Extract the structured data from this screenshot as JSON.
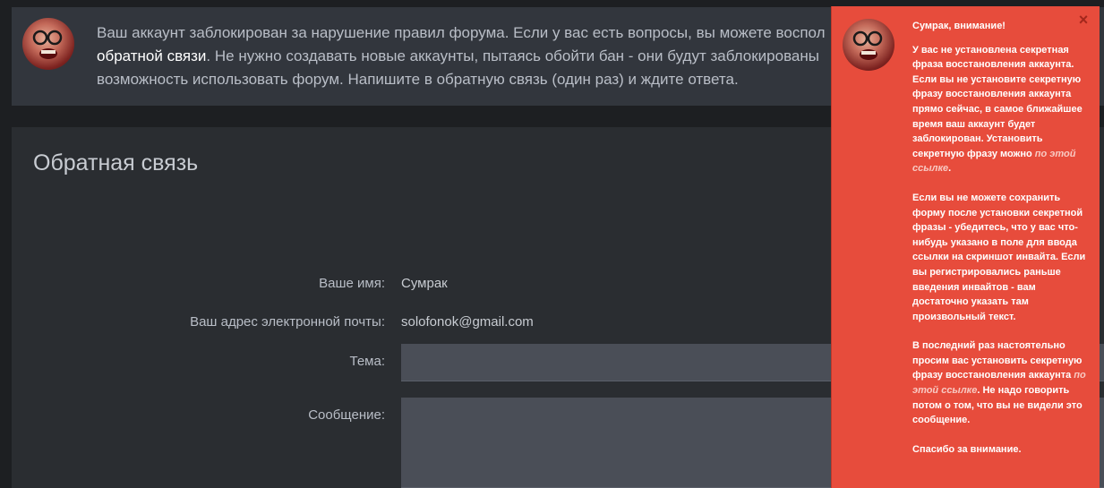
{
  "notice": {
    "text_before_link": "Ваш аккаунт заблокирован за нарушение правил форума. Если у вас есть вопросы, вы можете воспол",
    "link_text": "обратной связи",
    "text_after_link": ". Не нужно создавать новые аккаунты, пытаясь обойти бан - они будут заблокированы",
    "line3": "возможность использовать форум. Напишите в обратную связь (один раз) и ждите ответа."
  },
  "page": {
    "title": "Обратная связь"
  },
  "form": {
    "name_label": "Ваше имя:",
    "name_value": "Сумрак",
    "email_label": "Ваш адрес электронной почты:",
    "email_value": "solofonok@gmail.com",
    "subject_label": "Тема:",
    "subject_value": "",
    "message_label": "Сообщение:",
    "message_value": ""
  },
  "alert": {
    "close_glyph": "×",
    "title": "Сумрак, внимание!",
    "p1_text": "У вас не установлена секретная фраза восстановления аккаунта. Если вы не установите секретную фразу восстановления аккаунта прямо сейчас, в самое ближайшее время ваш аккаунт будет заблокирован. Установить секретную фразу можно ",
    "p1_link": "по этой ссылке",
    "p1_end": ".",
    "p2_text": "Если вы не можете сохранить форму после установки секретной фразы - убедитесь, что у вас что-нибудь указано в поле для ввода ссылки на скриншот инвайта. Если вы регистрировались раньше введения инвайтов - вам достаточно указать там произвольный текст.",
    "p3_text": "В последний раз настоятельно просим вас установить секретную фразу восстановления аккаунта ",
    "p3_link": "по этой ссылке",
    "p3_end": ". Не надо говорить потом о том, что вы не видели это сообщение.",
    "p4_text": "Спасибо за внимание."
  },
  "colors": {
    "alert_background": "#e74c3c",
    "page_background": "#1d1f22",
    "panel_background": "#2a2d31",
    "notice_background": "#32363d",
    "input_background": "#4a4e57"
  }
}
